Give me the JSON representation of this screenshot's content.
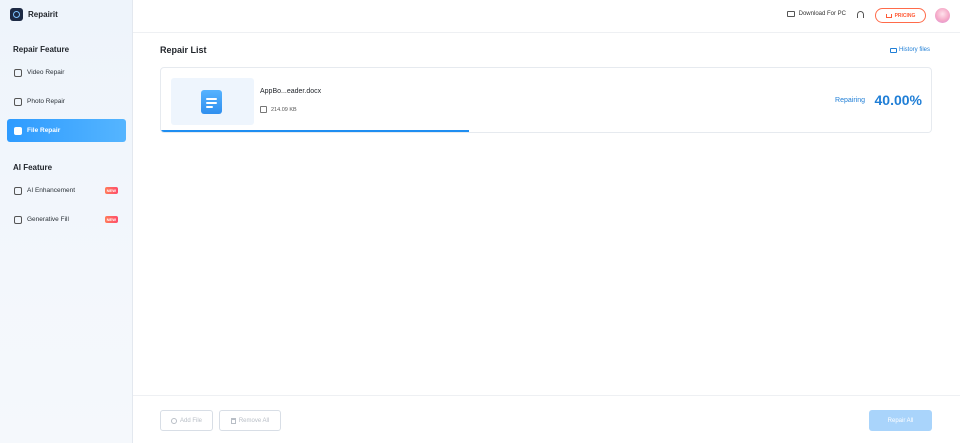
{
  "app": {
    "name": "Repairit"
  },
  "sidebar": {
    "repair_section_title": "Repair Feature",
    "repair_items": [
      {
        "label": "Video Repair",
        "icon": "video-icon"
      },
      {
        "label": "Photo Repair",
        "icon": "photo-icon"
      },
      {
        "label": "File Repair",
        "icon": "file-icon",
        "active": true
      }
    ],
    "ai_section_title": "AI Feature",
    "ai_items": [
      {
        "label": "AI Enhancement",
        "icon": "ai-enhance-icon",
        "badge": "NEW"
      },
      {
        "label": "Generative Fill",
        "icon": "generative-fill-icon",
        "badge": "NEW"
      }
    ]
  },
  "topbar": {
    "download_label": "Download For PC",
    "pricing_label": "PRICING"
  },
  "main": {
    "title": "Repair List",
    "history_label": "History files",
    "items": [
      {
        "file_name": "AppBo...eader.docx",
        "file_size": "214.09 KB",
        "status": "Repairing",
        "percent": "40.00%",
        "progress": 0.4
      }
    ]
  },
  "footer": {
    "add_file_label": "Add File",
    "remove_all_label": "Remove All",
    "repair_all_label": "Repair All"
  },
  "colors": {
    "accent": "#1f8ef1",
    "pricing": "#ff5a36",
    "badge": "#ff5a5f"
  }
}
